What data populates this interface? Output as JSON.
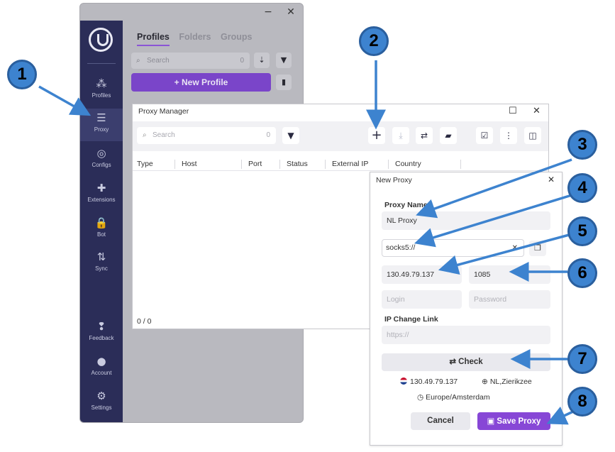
{
  "app": {
    "window_controls": {
      "minimize": "−",
      "close": "✕"
    },
    "sidebar": [
      {
        "label": "Profiles",
        "icon": "profiles-icon"
      },
      {
        "label": "Proxy",
        "icon": "server-icon"
      },
      {
        "label": "Configs",
        "icon": "fingerprint-icon"
      },
      {
        "label": "Extensions",
        "icon": "puzzle-icon"
      },
      {
        "label": "Bot",
        "icon": "lock-icon"
      },
      {
        "label": "Sync",
        "icon": "sync-icon"
      },
      {
        "label": "Feedback",
        "icon": "feedback-icon"
      },
      {
        "label": "Account",
        "icon": "account-icon"
      },
      {
        "label": "Settings",
        "icon": "gear-icon"
      }
    ],
    "tabs": [
      "Profiles",
      "Folders",
      "Groups"
    ],
    "search": {
      "placeholder": "Search",
      "count": "0"
    },
    "new_profile_label": "+ New Profile"
  },
  "proxy_manager": {
    "title": "Proxy Manager",
    "search": {
      "placeholder": "Search",
      "count": "0"
    },
    "columns": [
      "Type",
      "Host",
      "Port",
      "Status",
      "External IP",
      "Country"
    ],
    "footer": "0 / 0"
  },
  "new_proxy": {
    "title": "New Proxy",
    "proxy_name_label": "Proxy Name",
    "proxy_name_value": "NL Proxy",
    "protocol_value": "socks5://",
    "host_value": "130.49.79.137",
    "port_value": "1085",
    "login_placeholder": "Login",
    "password_placeholder": "Password",
    "ip_change_label": "IP Change Link",
    "ip_change_placeholder": "https://",
    "check_label": "⇄ Check",
    "result_ip": "130.49.79.137",
    "result_location": "NL,Zierikzee",
    "result_timezone": "Europe/Amsterdam",
    "cancel_label": "Cancel",
    "save_label": "Save Proxy"
  },
  "callouts": [
    "1",
    "2",
    "3",
    "4",
    "5",
    "6",
    "7",
    "8"
  ],
  "colors": {
    "accent": "#7a45c9",
    "sidebar": "#2b2d58",
    "callout": "#3d83cf"
  }
}
